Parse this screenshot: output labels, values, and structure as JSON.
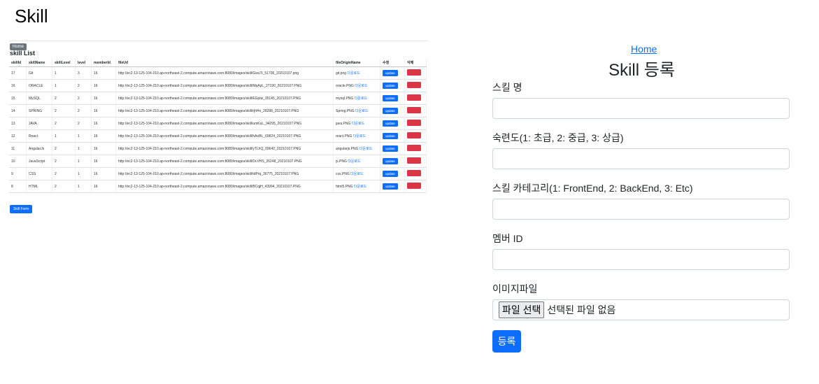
{
  "page": {
    "title": "Skill"
  },
  "list": {
    "home_label": "Home",
    "title": "skill List",
    "columns": [
      "skillId",
      "skillName",
      "skillLevel",
      "level",
      "memberId",
      "fileUrl",
      "fileOriginName",
      "수정",
      "삭제"
    ],
    "update_label": "update",
    "download_label": "다운로드",
    "rows": [
      {
        "skillId": "17",
        "skillName": "Git",
        "skillLevel": "1",
        "level": "3",
        "memberId": "16",
        "fileUrl": "http://ec2-13-125-104-210.ap-northeast-2.compute.amazonaws.com:8080/images/skill/GwuTi_51706_20210107.png",
        "fileOriginName": "git.png"
      },
      {
        "skillId": "16",
        "skillName": "ORACLE",
        "skillLevel": "1",
        "level": "2",
        "memberId": "16",
        "fileUrl": "http://ec2-13-125-104-210.ap-northeast-2.compute.amazonaws.com:8080/images/skill/MpApL_27190_20210107.PNG",
        "fileOriginName": "oracle.PNG"
      },
      {
        "skillId": "15",
        "skillName": "MySQL",
        "skillLevel": "2",
        "level": "2",
        "memberId": "16",
        "fileUrl": "http://ec2-13-125-104-210.ap-northeast-2.compute.amazonaws.com:8080/images/skill/EGpiw_35145_20210107.PNG",
        "fileOriginName": "mysql.PNG"
      },
      {
        "skillId": "14",
        "skillName": "SPRING",
        "skillLevel": "2",
        "level": "2",
        "memberId": "16",
        "fileUrl": "http://ec2-13-125-104-210.ap-northeast-2.compute.amazonaws.com:8080/images/skill/rjhHn_28288_20210107.PNG",
        "fileOriginName": "Spring.PNG"
      },
      {
        "skillId": "13",
        "skillName": "JAVA",
        "skillLevel": "2",
        "level": "2",
        "memberId": "16",
        "fileUrl": "http://ec2-13-125-104-210.ap-northeast-2.compute.amazonaws.com:8080/images/skill/umKuL_94295_20210107.PNG",
        "fileOriginName": "java.PNG"
      },
      {
        "skillId": "12",
        "skillName": "React",
        "skillLevel": "1",
        "level": "1",
        "memberId": "16",
        "fileUrl": "http://ec2-13-125-104-210.ap-northeast-2.compute.amazonaws.com:8080/images/skill/hAoBL_69824_20210107.PNG",
        "fileOriginName": "react.PNG"
      },
      {
        "skillId": "11",
        "skillName": "AngularJs",
        "skillLevel": "2",
        "level": "1",
        "memberId": "16",
        "fileUrl": "http://ec2-13-125-104-210.ap-northeast-2.compute.amazonaws.com:8080/images/skill/yTLhQ_09642_20210107.PNG",
        "fileOriginName": "angularjs.PNG"
      },
      {
        "skillId": "10",
        "skillName": "JavaScript",
        "skillLevel": "2",
        "level": "1",
        "memberId": "16",
        "fileUrl": "http://ec2-13-125-104-210.ap-northeast-2.compute.amazonaws.com:8080/images/skill/DcVHS_26248_20210107.PNG",
        "fileOriginName": "js.PNG"
      },
      {
        "skillId": "9",
        "skillName": "CSS",
        "skillLevel": "2",
        "level": "1",
        "memberId": "16",
        "fileUrl": "http://ec2-13-125-104-210.ap-northeast-2.compute.amazonaws.com:8080/images/skill/tdPrq_36775_20210107.PNG",
        "fileOriginName": "css.PNG"
      },
      {
        "skillId": "8",
        "skillName": "HTML",
        "skillLevel": "2",
        "level": "1",
        "memberId": "16",
        "fileUrl": "http://ec2-13-125-104-210.ap-northeast-2.compute.amazonaws.com:8080/images/skill/BCqjH_43994_20210107.PNG",
        "fileOriginName": "html5.PNG"
      }
    ],
    "form_button_label": "Skill Form"
  },
  "form": {
    "home_link": "Home",
    "title": "Skill 등록",
    "skill_name_label": "스킬 명",
    "skill_level_label": "숙련도(1: 초급, 2: 중급, 3: 상급)",
    "skill_category_label": "스킬 카테고리(1: FrontEnd, 2: BackEnd, 3: Etc)",
    "member_id_label": "멤버 ID",
    "image_file_label": "이미지파일",
    "file_button_label": "파일 선택",
    "file_none_text": "선택된 파일 없음",
    "submit_label": "등록"
  },
  "colors": {
    "primary": "#0d6efd",
    "danger": "#dc3545",
    "secondary": "#6c757d"
  }
}
